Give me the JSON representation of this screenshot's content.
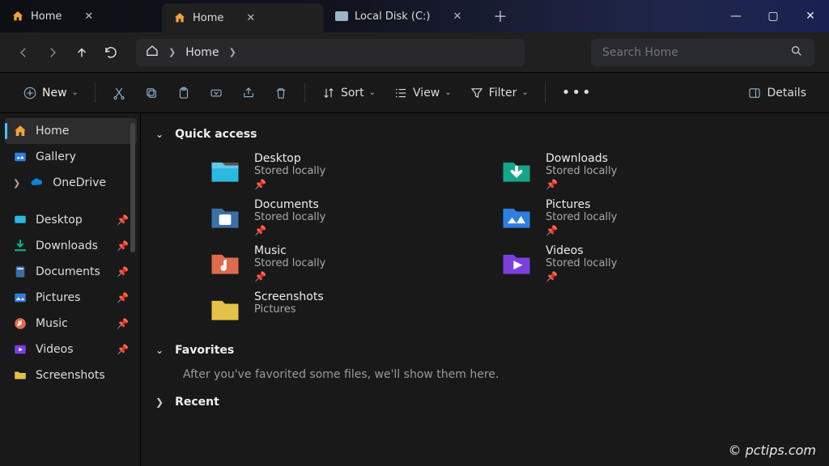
{
  "titlebar": {
    "tabs": [
      {
        "label": "Home",
        "icon": "home-icon"
      },
      {
        "label": "Home",
        "icon": "home-icon"
      },
      {
        "label": "Local Disk (C:)",
        "icon": "drive-icon"
      }
    ],
    "new_tab_tooltip": "New tab"
  },
  "nav": {
    "breadcrumb": "Home"
  },
  "search": {
    "placeholder": "Search Home"
  },
  "toolbar": {
    "new_label": "New",
    "sort_label": "Sort",
    "view_label": "View",
    "filter_label": "Filter",
    "details_label": "Details"
  },
  "sidebar": {
    "top": [
      {
        "label": "Home",
        "icon": "home"
      },
      {
        "label": "Gallery",
        "icon": "gallery"
      },
      {
        "label": "OneDrive",
        "icon": "onedrive",
        "expandable": true
      }
    ],
    "pinned": [
      {
        "label": "Desktop",
        "icon": "desktop"
      },
      {
        "label": "Downloads",
        "icon": "downloads"
      },
      {
        "label": "Documents",
        "icon": "documents"
      },
      {
        "label": "Pictures",
        "icon": "pictures"
      },
      {
        "label": "Music",
        "icon": "music"
      },
      {
        "label": "Videos",
        "icon": "videos"
      },
      {
        "label": "Screenshots",
        "icon": "folder"
      }
    ]
  },
  "content": {
    "quick_access_header": "Quick access",
    "quick_access": [
      {
        "title": "Desktop",
        "sub": "Stored locally",
        "pinned": true,
        "icon": "desktop",
        "color": "#2bb9e0"
      },
      {
        "title": "Downloads",
        "sub": "Stored locally",
        "pinned": true,
        "icon": "downloads",
        "color": "#15a68a"
      },
      {
        "title": "Documents",
        "sub": "Stored locally",
        "pinned": true,
        "icon": "documents",
        "color": "#3b6fa8"
      },
      {
        "title": "Pictures",
        "sub": "Stored locally",
        "pinned": true,
        "icon": "pictures",
        "color": "#2e7fe0"
      },
      {
        "title": "Music",
        "sub": "Stored locally",
        "pinned": true,
        "icon": "music",
        "color": "#e06b4c"
      },
      {
        "title": "Videos",
        "sub": "Stored locally",
        "pinned": true,
        "icon": "videos",
        "color": "#7b3fe0"
      },
      {
        "title": "Screenshots",
        "sub": "Pictures",
        "pinned": false,
        "icon": "folder",
        "color": "#e6c14a"
      }
    ],
    "favorites_header": "Favorites",
    "favorites_hint": "After you've favorited some files, we'll show them here.",
    "recent_header": "Recent"
  },
  "watermark": "© pctips.com"
}
